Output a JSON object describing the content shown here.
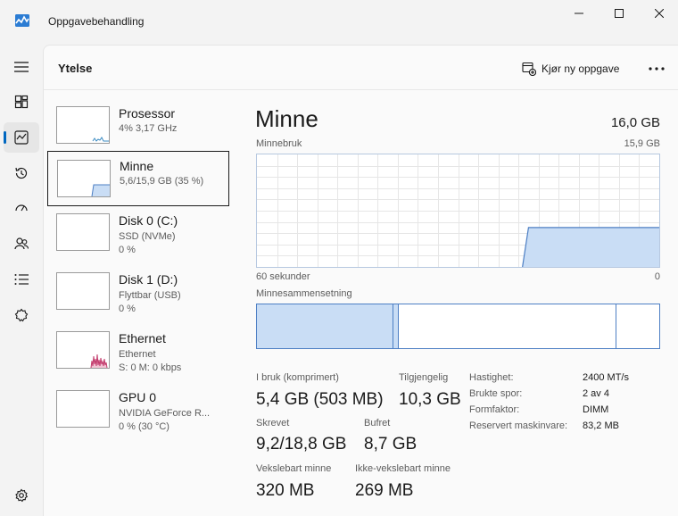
{
  "window": {
    "title": "Oppgavebehandling"
  },
  "nav": {
    "items": [
      {
        "name": "hamburger-menu-icon"
      },
      {
        "name": "processes-icon"
      },
      {
        "name": "performance-icon"
      },
      {
        "name": "app-history-icon"
      },
      {
        "name": "startup-apps-icon"
      },
      {
        "name": "users-icon"
      },
      {
        "name": "details-icon"
      },
      {
        "name": "services-icon"
      },
      {
        "name": "settings-icon"
      }
    ],
    "active_index": 2
  },
  "header": {
    "title": "Ytelse",
    "run_task_label": "Kjør ny oppgave"
  },
  "devices": [
    {
      "name": "Prosessor",
      "line1": "4% 3,17 GHz",
      "line2": "",
      "selected": false
    },
    {
      "name": "Minne",
      "line1": "5,6/15,9 GB (35 %)",
      "line2": "",
      "selected": true
    },
    {
      "name": "Disk 0 (C:)",
      "line1": "SSD (NVMe)",
      "line2": "0 %",
      "selected": false
    },
    {
      "name": "Disk 1 (D:)",
      "line1": "Flyttbar (USB)",
      "line2": "0 %",
      "selected": false
    },
    {
      "name": "Ethernet",
      "line1": "Ethernet",
      "line2": "S: 0 M: 0 kbps",
      "selected": false
    },
    {
      "name": "GPU 0",
      "line1": "NVIDIA GeForce R...",
      "line2": "0 % (30 °C)",
      "selected": false
    }
  ],
  "detail": {
    "title": "Minne",
    "total": "16,0 GB",
    "usage_label": "Minnebruk",
    "usage_max": "15,9 GB",
    "time_left": "60 sekunder",
    "time_right": "0",
    "composition_label": "Minnesammensetning",
    "usage_fraction": 0.35,
    "composition": {
      "in_use_fraction": 0.34,
      "modified_fraction": 0.013,
      "standby_fraction": 0.54,
      "free_fraction": 0.107
    },
    "stats": {
      "in_use_label": "I bruk (komprimert)",
      "in_use_value": "5,4 GB (503 MB)",
      "available_label": "Tilgjengelig",
      "available_value": "10,3 GB",
      "committed_label": "Skrevet",
      "committed_value": "9,2/18,8 GB",
      "cached_label": "Bufret",
      "cached_value": "8,7 GB",
      "paged_label": "Vekslebart minne",
      "paged_value": "320 MB",
      "nonpaged_label": "Ikke-vekslebart minne",
      "nonpaged_value": "269 MB"
    },
    "specs": [
      {
        "key": "Hastighet:",
        "value": "2400 MT/s"
      },
      {
        "key": "Brukte spor:",
        "value": "2 av 4"
      },
      {
        "key": "Formfaktor:",
        "value": "DIMM"
      },
      {
        "key": "Reservert maskinvare:",
        "value": "83,2 MB"
      }
    ]
  },
  "colors": {
    "accent": "#0067c0",
    "memory_line": "#4d7fc4",
    "memory_fill": "#c9ddf5",
    "cpu_line": "#3b8bc2",
    "ethernet_line": "#c2396b"
  }
}
